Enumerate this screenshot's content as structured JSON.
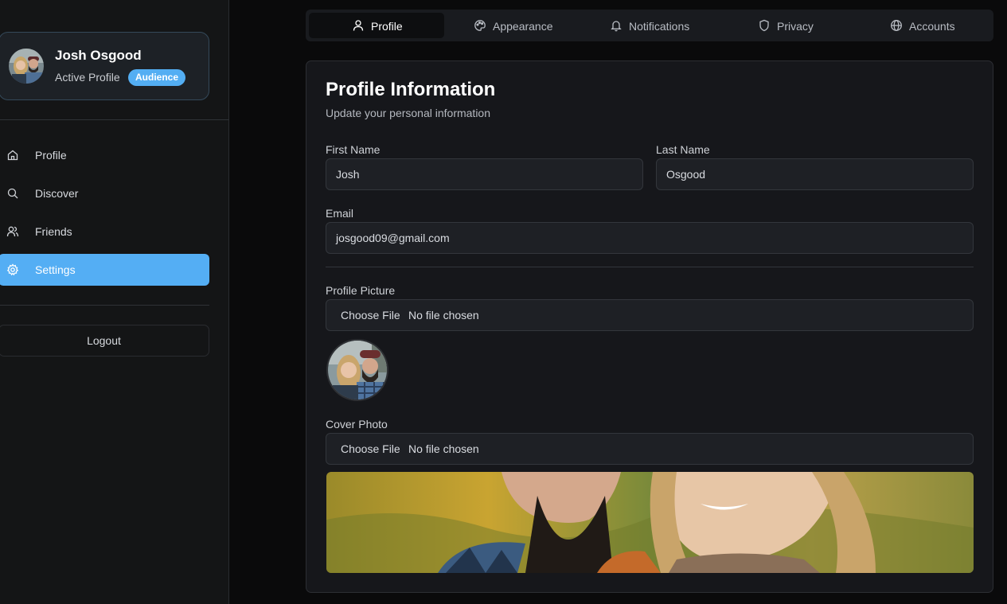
{
  "user": {
    "name": "Josh Osgood",
    "status": "Active Profile",
    "badge": "Audience"
  },
  "sidebar": {
    "items": [
      {
        "label": "Profile",
        "icon": "home-icon"
      },
      {
        "label": "Discover",
        "icon": "search-icon"
      },
      {
        "label": "Friends",
        "icon": "users-icon"
      },
      {
        "label": "Settings",
        "icon": "gear-icon",
        "active": true
      }
    ],
    "logout_label": "Logout"
  },
  "tabs": [
    {
      "label": "Profile",
      "icon": "user-icon",
      "active": true
    },
    {
      "label": "Appearance",
      "icon": "palette-icon"
    },
    {
      "label": "Notifications",
      "icon": "bell-icon"
    },
    {
      "label": "Privacy",
      "icon": "shield-icon"
    },
    {
      "label": "Accounts",
      "icon": "globe-icon"
    }
  ],
  "form": {
    "title": "Profile Information",
    "subtitle": "Update your personal information",
    "first_name": {
      "label": "First Name",
      "value": "Josh"
    },
    "last_name": {
      "label": "Last Name",
      "value": "Osgood"
    },
    "email": {
      "label": "Email",
      "value": "josgood09@gmail.com"
    },
    "profile_picture": {
      "label": "Profile Picture",
      "button": "Choose File",
      "status": "No file chosen"
    },
    "cover_photo": {
      "label": "Cover Photo",
      "button": "Choose File",
      "status": "No file chosen"
    }
  },
  "colors": {
    "accent": "#54aef4",
    "panel": "#16171b",
    "background": "#0a0a0b"
  }
}
